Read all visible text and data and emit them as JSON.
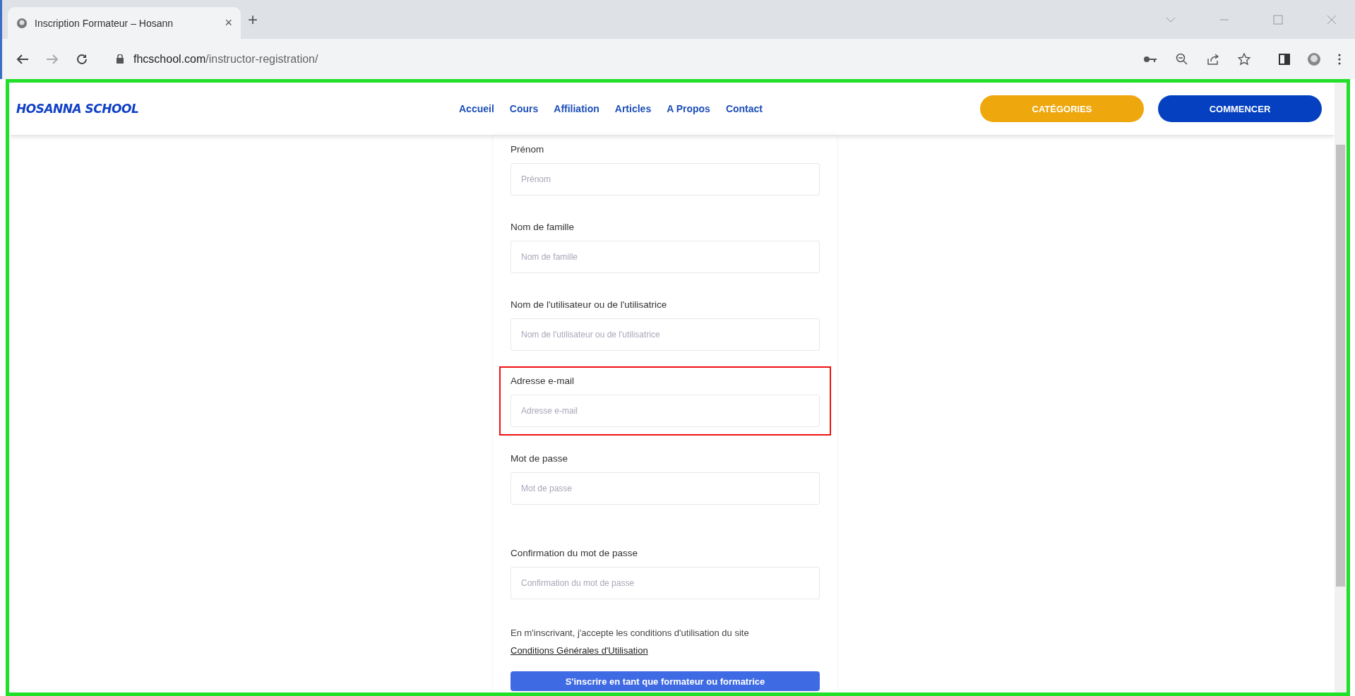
{
  "browser": {
    "tab": {
      "title": "Inscription Formateur – Hosann",
      "close": "×"
    },
    "new_tab": "+",
    "url": {
      "domain": "fhcschool.com",
      "path": "/instructor-registration/"
    }
  },
  "header": {
    "logo": "HOSANNA SCHOOL",
    "nav": [
      "Accueil",
      "Cours",
      "Affiliation",
      "Articles",
      "A Propos",
      "Contact"
    ],
    "buttons": [
      {
        "label": "CATÉGORIES",
        "kind": "secondary"
      },
      {
        "label": "COMMENCER",
        "kind": "primary"
      }
    ]
  },
  "form": {
    "fields": [
      {
        "label": "Prénom",
        "placeholder": "Prénom",
        "highlighted": false
      },
      {
        "label": "Nom de famille",
        "placeholder": "Nom de famille",
        "highlighted": false
      },
      {
        "label": "Nom de l'utilisateur ou de l'utilisatrice",
        "placeholder": "Nom de l'utilisateur ou de l'utilisatrice",
        "highlighted": false
      },
      {
        "label": "Adresse e-mail",
        "placeholder": "Adresse e-mail",
        "highlighted": true
      },
      {
        "label": "Mot de passe",
        "placeholder": "Mot de passe",
        "highlighted": false
      },
      {
        "label": "Confirmation du mot de passe",
        "placeholder": "Confirmation du mot de passe",
        "highlighted": false
      }
    ],
    "terms": "En m'inscrivant, j'accepte les conditions d'utilisation du site",
    "terms_link": "Conditions Générales d'Utilisation",
    "submit": "S'inscrire en tant que formateur ou formatrice"
  }
}
